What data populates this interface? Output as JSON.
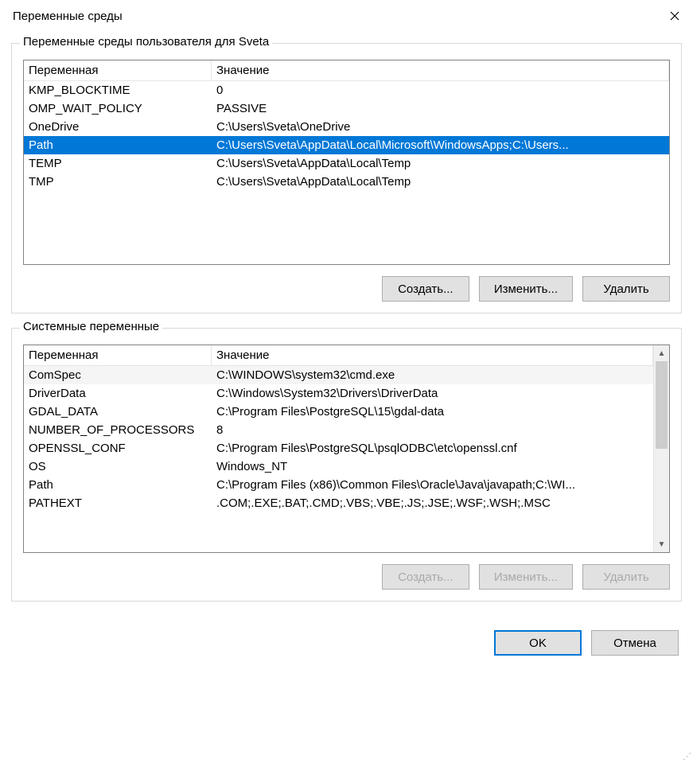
{
  "dialog": {
    "title": "Переменные среды"
  },
  "userVars": {
    "label": "Переменные среды пользователя для Sveta",
    "columns": {
      "name": "Переменная",
      "value": "Значение"
    },
    "rows": [
      {
        "name": "KMP_BLOCKTIME",
        "value": "0",
        "selected": false
      },
      {
        "name": "OMP_WAIT_POLICY",
        "value": "PASSIVE",
        "selected": false
      },
      {
        "name": "OneDrive",
        "value": "C:\\Users\\Sveta\\OneDrive",
        "selected": false
      },
      {
        "name": "Path",
        "value": "C:\\Users\\Sveta\\AppData\\Local\\Microsoft\\WindowsApps;C:\\Users...",
        "selected": true
      },
      {
        "name": "TEMP",
        "value": "C:\\Users\\Sveta\\AppData\\Local\\Temp",
        "selected": false
      },
      {
        "name": "TMP",
        "value": "C:\\Users\\Sveta\\AppData\\Local\\Temp",
        "selected": false
      }
    ],
    "buttons": {
      "create": "Создать...",
      "edit": "Изменить...",
      "delete": "Удалить"
    }
  },
  "systemVars": {
    "label": "Системные переменные",
    "columns": {
      "name": "Переменная",
      "value": "Значение"
    },
    "rows": [
      {
        "name": "ComSpec",
        "value": "C:\\WINDOWS\\system32\\cmd.exe",
        "alt": true
      },
      {
        "name": "DriverData",
        "value": "C:\\Windows\\System32\\Drivers\\DriverData",
        "alt": false
      },
      {
        "name": "GDAL_DATA",
        "value": "C:\\Program Files\\PostgreSQL\\15\\gdal-data",
        "alt": false
      },
      {
        "name": "NUMBER_OF_PROCESSORS",
        "value": "8",
        "alt": false
      },
      {
        "name": "OPENSSL_CONF",
        "value": "C:\\Program Files\\PostgreSQL\\psqlODBC\\etc\\openssl.cnf",
        "alt": false
      },
      {
        "name": "OS",
        "value": "Windows_NT",
        "alt": false
      },
      {
        "name": "Path",
        "value": "C:\\Program Files (x86)\\Common Files\\Oracle\\Java\\javapath;C:\\WI...",
        "alt": false
      },
      {
        "name": "PATHEXT",
        "value": ".COM;.EXE;.BAT;.CMD;.VBS;.VBE;.JS;.JSE;.WSF;.WSH;.MSC",
        "alt": false
      }
    ],
    "buttons": {
      "create": "Создать...",
      "edit": "Изменить...",
      "delete": "Удалить"
    }
  },
  "dialogButtons": {
    "ok": "OK",
    "cancel": "Отмена"
  }
}
